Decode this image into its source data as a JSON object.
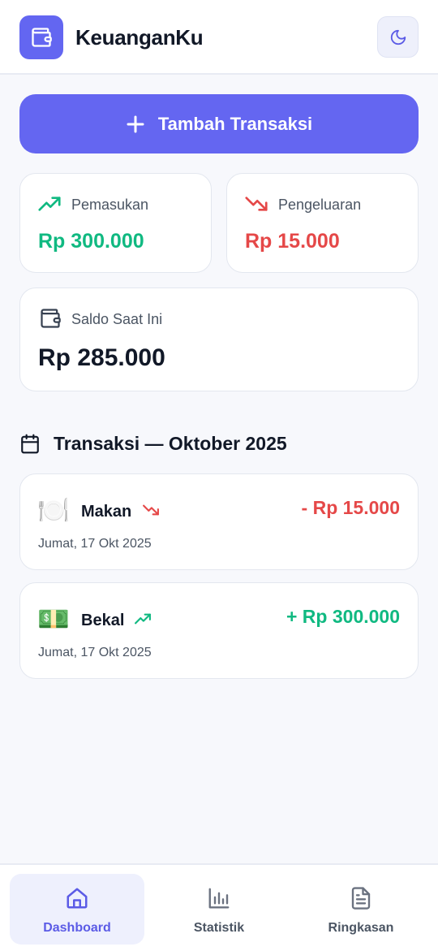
{
  "header": {
    "app_title": "KeuanganKu"
  },
  "actions": {
    "add_transaction_label": "Tambah Transaksi"
  },
  "summary": {
    "income_label": "Pemasukan",
    "income_value": "Rp 300.000",
    "expense_label": "Pengeluaran",
    "expense_value": "Rp 15.000",
    "balance_label": "Saldo Saat Ini",
    "balance_value": "Rp 285.000"
  },
  "transactions": {
    "section_title": "Transaksi — Oktober 2025",
    "items": [
      {
        "emoji": "🍽️",
        "name": "Makan",
        "type": "expense",
        "amount": "- Rp 15.000",
        "date": "Jumat, 17 Okt 2025"
      },
      {
        "emoji": "💵",
        "name": "Bekal",
        "type": "income",
        "amount": "+ Rp 300.000",
        "date": "Jumat, 17 Okt 2025"
      }
    ]
  },
  "nav": {
    "items": [
      {
        "label": "Dashboard",
        "icon": "home-icon",
        "active": true
      },
      {
        "label": "Statistik",
        "icon": "bar-chart-icon",
        "active": false
      },
      {
        "label": "Ringkasan",
        "icon": "document-icon",
        "active": false
      }
    ]
  },
  "colors": {
    "primary": "#6366f1",
    "income": "#10b981",
    "expense": "#e54848",
    "background": "#f7f8fc"
  }
}
